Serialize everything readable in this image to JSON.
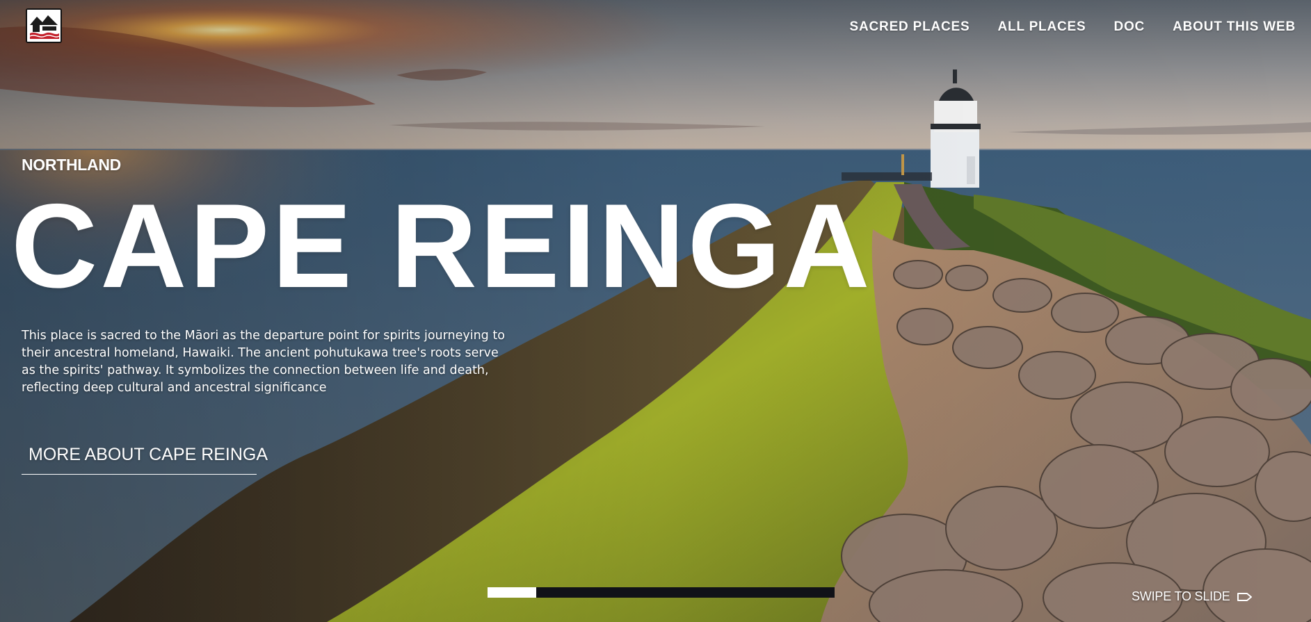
{
  "header": {
    "logo_name": "site-logo",
    "nav": [
      {
        "label": "SACRED PLACES"
      },
      {
        "label": "ALL PLACES"
      },
      {
        "label": "DOC"
      },
      {
        "label": "ABOUT THIS WEB"
      }
    ]
  },
  "hero": {
    "region": "NORTHLAND",
    "title": "CAPE REINGA",
    "description": "This place is sacred to the Māori as the departure point for spirits journeying to their ancestral homeland, Hawaiki. The ancient pohutukawa tree's roots serve as the spirits' pathway. It symbolizes the connection between life and death, reflecting deep cultural and ancestral significance",
    "cta_label": "MORE ABOUT CAPE REINGA"
  },
  "slider": {
    "progress_fraction": 0.14,
    "swipe_label": "SWIPE TO SLIDE",
    "swipe_icon": "arrow-right-icon"
  },
  "colors": {
    "text": "#ffffff",
    "progress_track": "#111218",
    "progress_fill": "#ffffff"
  }
}
